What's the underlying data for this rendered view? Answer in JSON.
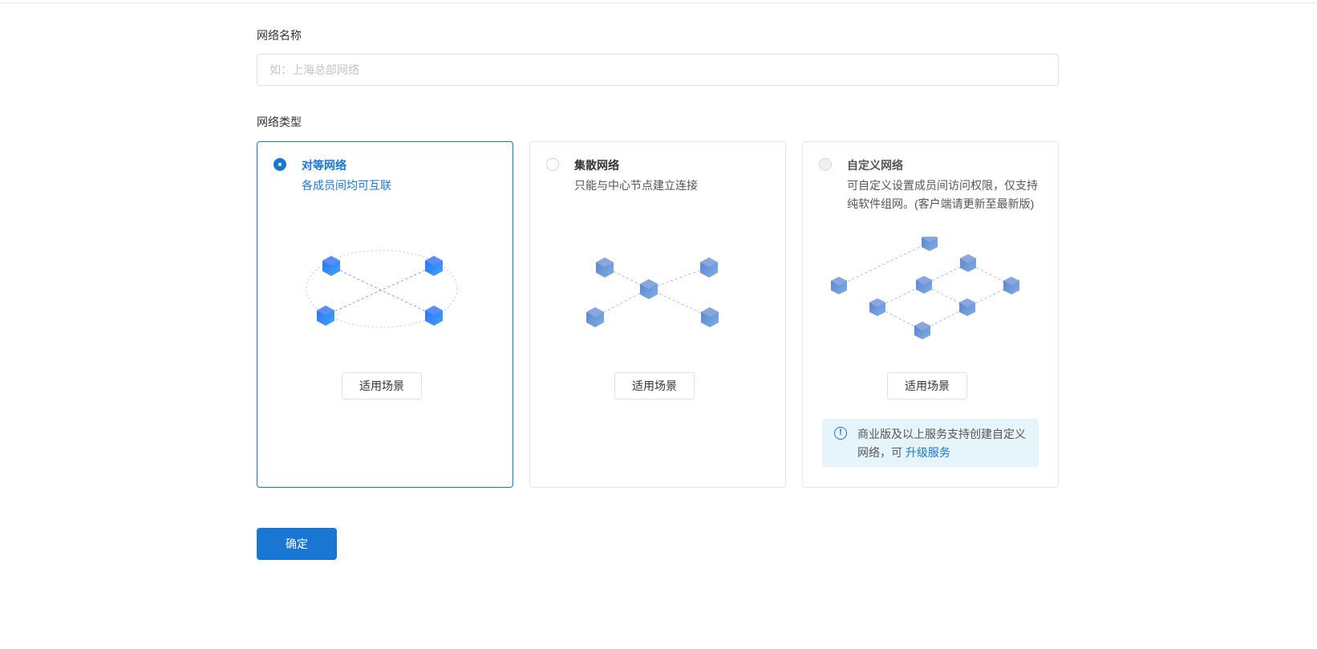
{
  "form": {
    "name_label": "网络名称",
    "name_placeholder": "如：上海总部网络",
    "name_value": "",
    "type_label": "网络类型"
  },
  "network_types": [
    {
      "title": "对等网络",
      "description": "各成员间均可互联",
      "selected": true,
      "scene_button": "适用场景"
    },
    {
      "title": "集散网络",
      "description": "只能与中心节点建立连接",
      "selected": false,
      "scene_button": "适用场景"
    },
    {
      "title": "自定义网络",
      "description": "可自定义设置成员间访问权限，仅支持纯软件组网。(客户端请更新至最新版)",
      "selected": false,
      "disabled": true,
      "scene_button": "适用场景"
    }
  ],
  "notice": {
    "text": "商业版及以上服务支持创建自定义网络，可 ",
    "link": "升级服务",
    "icon": "info-icon"
  },
  "confirm_button": "确定",
  "colors": {
    "primary": "#1976d2",
    "border": "#e4e7ed",
    "notice_bg": "#e6f4fb",
    "node": "#6f8fd0"
  }
}
